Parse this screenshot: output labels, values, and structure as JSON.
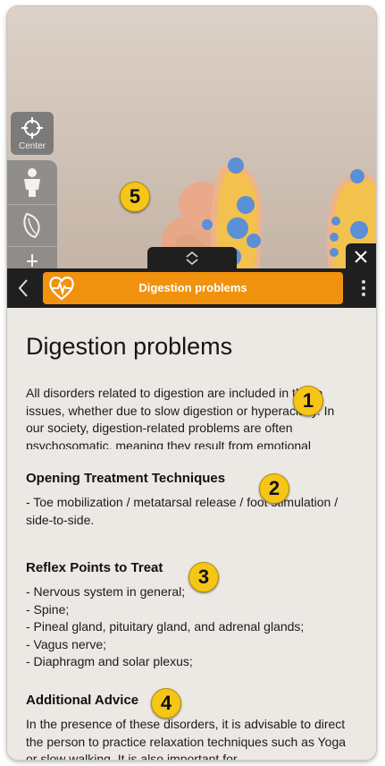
{
  "viewer": {
    "center_label": "Center",
    "tools": [
      "body-icon",
      "muscle-icon",
      "skeleton-icon"
    ]
  },
  "header": {
    "title": "Digestion problems",
    "back_icon": "chevron-left-icon",
    "category_icon": "heart-pulse-icon",
    "menu_icon": "more-vertical-icon",
    "accent": "#f0920e"
  },
  "article": {
    "heading": "Digestion problems",
    "intro": "All disorders related to digestion are included in these issues, whether due to slow digestion or hyperacidity. In our society, digestion-related problems are often psychosomatic, meaning they result from emotional",
    "sections": [
      {
        "title": "Opening Treatment Techniques",
        "text": "- Toe mobilization / metatarsal release / foot stimulation / side-to-side."
      },
      {
        "title": "Reflex Points to Treat",
        "items": [
          "- Nervous system in general;",
          "- Spine;",
          "- Pineal gland, pituitary gland, and adrenal glands;",
          "- Vagus nerve;",
          "- Diaphragm and solar plexus;"
        ]
      },
      {
        "title": "Additional Advice",
        "text": "In the presence of these disorders, it is advisable to direct the person to practice relaxation techniques such as Yoga or slow walking. It is also important for"
      }
    ]
  },
  "callouts": [
    "1",
    "2",
    "3",
    "4",
    "5"
  ],
  "colors": {
    "callout": "#f5c518",
    "foot": "#f0b27a",
    "reflex_area": "#f2c14e",
    "reflex_point": "#5b8fd6"
  }
}
